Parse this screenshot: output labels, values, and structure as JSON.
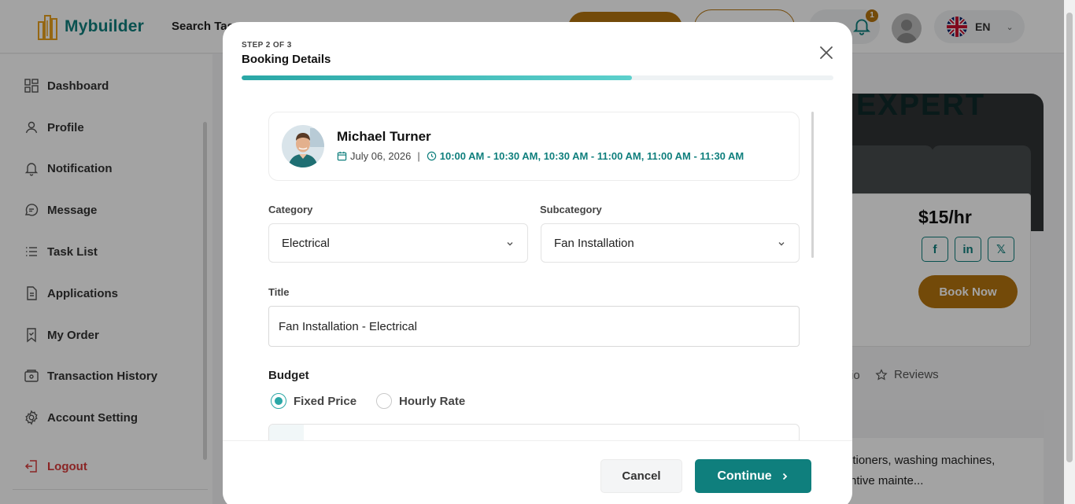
{
  "app": {
    "logo_text": "Mybuilder",
    "search_label": "Search Tas",
    "notification_count": "1",
    "language": "EN"
  },
  "sidebar": {
    "items": [
      {
        "label": "Dashboard",
        "icon": "grid-icon"
      },
      {
        "label": "Profile",
        "icon": "user-icon"
      },
      {
        "label": "Notification",
        "icon": "bell-icon"
      },
      {
        "label": "Message",
        "icon": "chat-icon"
      },
      {
        "label": "Task List",
        "icon": "list-icon"
      },
      {
        "label": "Applications",
        "icon": "document-icon"
      },
      {
        "label": "My Order",
        "icon": "bookmark-icon"
      },
      {
        "label": "Transaction History",
        "icon": "wallet-icon"
      },
      {
        "label": "Account Setting",
        "icon": "gear-icon"
      }
    ],
    "logout": "Logout"
  },
  "background_page": {
    "banner_text": "EXPERT",
    "price": "$15/hr",
    "book_now": "Book Now",
    "tab_partial": "io",
    "reviews_tab": "Reviews",
    "description_line1": "itioners, washing machines,",
    "description_line2": "ntive mainte..."
  },
  "modal": {
    "step": "STEP 2 OF 3",
    "title": "Booking Details",
    "progress": 0.66,
    "provider": {
      "name": "Michael Turner",
      "date": "July 06, 2026",
      "separator": "|",
      "times": "10:00 AM - 10:30 AM, 10:30 AM - 11:00 AM, 11:00 AM - 11:30 AM"
    },
    "category": {
      "label": "Category",
      "value": "Electrical"
    },
    "subcategory": {
      "label": "Subcategory",
      "value": "Fan Installation"
    },
    "title_field": {
      "label": "Title",
      "value": "Fan Installation - Electrical"
    },
    "budget": {
      "label": "Budget",
      "options": [
        {
          "label": "Fixed Price",
          "selected": true
        },
        {
          "label": "Hourly Rate",
          "selected": false
        }
      ]
    },
    "buttons": {
      "cancel": "Cancel",
      "continue": "Continue"
    }
  },
  "colors": {
    "brand_teal": "#0f7f7d",
    "accent_orange": "#b5740f",
    "progress_teal": "#2aa7a6"
  }
}
